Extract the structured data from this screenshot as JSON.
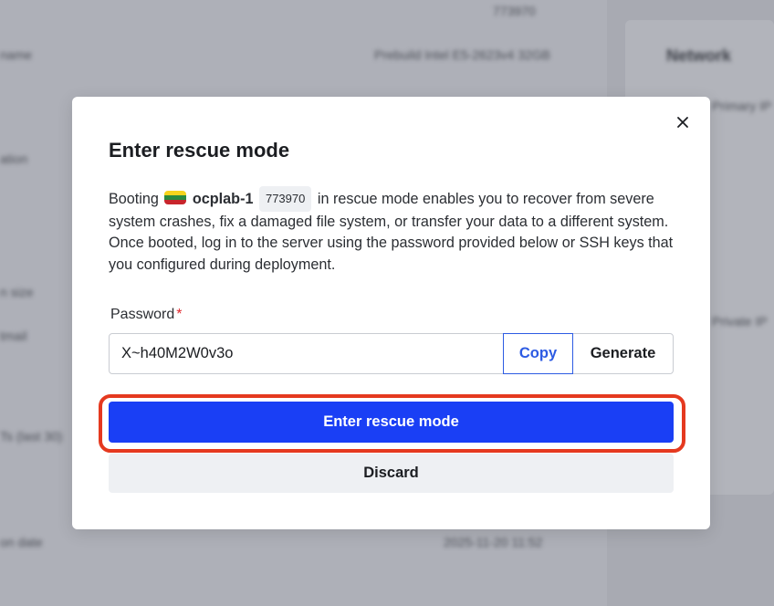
{
  "background": {
    "items": [
      {
        "text": "773970"
      },
      {
        "text": "name"
      },
      {
        "text": "Prebuild Intel E5-2623v4 32GB"
      },
      {
        "text": "Network"
      },
      {
        "text": "ation"
      },
      {
        "text": "Primary IP"
      },
      {
        "text": "n size"
      },
      {
        "text": "tmail"
      },
      {
        "text": "Private IP"
      },
      {
        "text": "Ts (last 30)"
      },
      {
        "text": "on date"
      },
      {
        "text": "2025-11-20 11:52"
      }
    ]
  },
  "modal": {
    "title": "Enter rescue mode",
    "description": {
      "prefix": "Booting",
      "server_name": "ocplab-1",
      "server_id": "773970",
      "suffix": "in rescue mode enables you to recover from severe system crashes, fix a damaged file system, or transfer your data to a different system. Once booted, log in to the server using the password provided below or SSH keys that you configured during deployment."
    },
    "flag_colors": [
      "#f7d41c",
      "#2b8a3e",
      "#c8252c"
    ],
    "password": {
      "label": "Password",
      "required_mark": "*",
      "value": "X~h40M2W0v3o",
      "copy_label": "Copy",
      "generate_label": "Generate"
    },
    "primary_button": "Enter rescue mode",
    "secondary_button": "Discard",
    "close_icon": "close-icon"
  },
  "colors": {
    "primary": "#1a3ff5",
    "copy_accent": "#2d5be3",
    "highlight": "#e5391f",
    "required": "#e0262b"
  }
}
